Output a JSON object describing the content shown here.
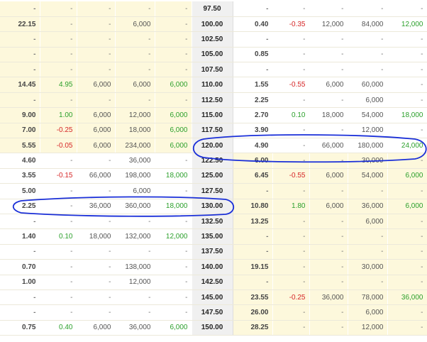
{
  "table": {
    "rows": [
      {
        "call": [
          "-",
          "-",
          "-",
          "-",
          "-"
        ],
        "strike": "97.50",
        "put": [
          "-",
          "-",
          "-",
          "-",
          "-"
        ],
        "call_itm": true
      },
      {
        "call": [
          "22.15",
          "-",
          "-",
          "6,000",
          "-"
        ],
        "strike": "100.00",
        "put": [
          "0.40",
          "-0.35",
          "12,000",
          "84,000",
          "12,000"
        ],
        "call_itm": true
      },
      {
        "call": [
          "-",
          "-",
          "-",
          "-",
          "-"
        ],
        "strike": "102.50",
        "put": [
          "-",
          "-",
          "-",
          "-",
          "-"
        ],
        "call_itm": true
      },
      {
        "call": [
          "-",
          "-",
          "-",
          "-",
          "-"
        ],
        "strike": "105.00",
        "put": [
          "0.85",
          "-",
          "-",
          "-",
          "-"
        ],
        "call_itm": true
      },
      {
        "call": [
          "-",
          "-",
          "-",
          "-",
          "-"
        ],
        "strike": "107.50",
        "put": [
          "-",
          "-",
          "-",
          "-",
          "-"
        ],
        "call_itm": true
      },
      {
        "call": [
          "14.45",
          "4.95",
          "6,000",
          "6,000",
          "6,000"
        ],
        "strike": "110.00",
        "put": [
          "1.55",
          "-0.55",
          "6,000",
          "60,000",
          "-"
        ],
        "call_itm": true
      },
      {
        "call": [
          "-",
          "-",
          "-",
          "-",
          "-"
        ],
        "strike": "112.50",
        "put": [
          "2.25",
          "-",
          "-",
          "6,000",
          "-"
        ],
        "call_itm": true
      },
      {
        "call": [
          "9.00",
          "1.00",
          "6,000",
          "12,000",
          "6,000"
        ],
        "strike": "115.00",
        "put": [
          "2.70",
          "0.10",
          "18,000",
          "54,000",
          "18,000"
        ],
        "call_itm": true
      },
      {
        "call": [
          "7.00",
          "-0.25",
          "6,000",
          "18,000",
          "6,000"
        ],
        "strike": "117.50",
        "put": [
          "3.90",
          "-",
          "-",
          "12,000",
          "-"
        ],
        "call_itm": true
      },
      {
        "call": [
          "5.55",
          "-0.05",
          "6,000",
          "234,000",
          "6,000"
        ],
        "strike": "120.00",
        "put": [
          "4.90",
          "-",
          "66,000",
          "180,000",
          "24,000"
        ],
        "call_itm": true
      },
      {
        "call": [
          "4.60",
          "-",
          "-",
          "36,000",
          "-"
        ],
        "strike": "122.50",
        "put": [
          "6.00",
          "-",
          "-",
          "30,000",
          "-"
        ],
        "call_itm": false
      },
      {
        "call": [
          "3.55",
          "-0.15",
          "66,000",
          "198,000",
          "18,000"
        ],
        "strike": "125.00",
        "put": [
          "6.45",
          "-0.55",
          "6,000",
          "54,000",
          "6,000"
        ],
        "call_itm": false
      },
      {
        "call": [
          "5.00",
          "-",
          "-",
          "6,000",
          "-"
        ],
        "strike": "127.50",
        "put": [
          "-",
          "-",
          "-",
          "-",
          "-"
        ],
        "call_itm": false
      },
      {
        "call": [
          "2.25",
          "-",
          "36,000",
          "360,000",
          "18,000"
        ],
        "strike": "130.00",
        "put": [
          "10.80",
          "1.80",
          "6,000",
          "36,000",
          "6,000"
        ],
        "call_itm": false
      },
      {
        "call": [
          "-",
          "-",
          "-",
          "-",
          "-"
        ],
        "strike": "132.50",
        "put": [
          "13.25",
          "-",
          "-",
          "6,000",
          "-"
        ],
        "call_itm": false
      },
      {
        "call": [
          "1.40",
          "0.10",
          "18,000",
          "132,000",
          "12,000"
        ],
        "strike": "135.00",
        "put": [
          "-",
          "-",
          "-",
          "-",
          "-"
        ],
        "call_itm": false
      },
      {
        "call": [
          "-",
          "-",
          "-",
          "-",
          "-"
        ],
        "strike": "137.50",
        "put": [
          "-",
          "-",
          "-",
          "-",
          "-"
        ],
        "call_itm": false
      },
      {
        "call": [
          "0.70",
          "-",
          "-",
          "138,000",
          "-"
        ],
        "strike": "140.00",
        "put": [
          "19.15",
          "-",
          "-",
          "30,000",
          "-"
        ],
        "call_itm": false
      },
      {
        "call": [
          "1.00",
          "-",
          "-",
          "12,000",
          "-"
        ],
        "strike": "142.50",
        "put": [
          "-",
          "-",
          "-",
          "-",
          "-"
        ],
        "call_itm": false
      },
      {
        "call": [
          "-",
          "-",
          "-",
          "-",
          "-"
        ],
        "strike": "145.00",
        "put": [
          "23.55",
          "-0.25",
          "36,000",
          "78,000",
          "36,000"
        ],
        "call_itm": false
      },
      {
        "call": [
          "-",
          "-",
          "-",
          "-",
          "-"
        ],
        "strike": "147.50",
        "put": [
          "26.00",
          "-",
          "-",
          "6,000",
          "-"
        ],
        "call_itm": false
      },
      {
        "call": [
          "0.75",
          "0.40",
          "6,000",
          "36,000",
          "6,000"
        ],
        "strike": "150.00",
        "put": [
          "28.25",
          "-",
          "-",
          "12,000",
          "-"
        ],
        "call_itm": false
      }
    ]
  },
  "annotations": {
    "color": "#1a2fd8",
    "circled_put_strike": "120.00",
    "circled_call_strike": "130.00"
  }
}
